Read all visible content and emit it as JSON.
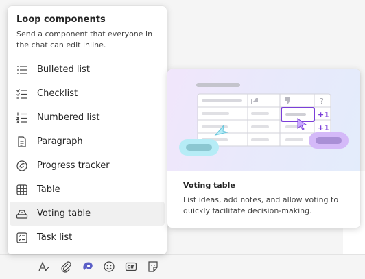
{
  "menu": {
    "title": "Loop components",
    "description": "Send a component that everyone in the chat can edit inline.",
    "items": [
      {
        "label": "Bulleted list",
        "icon": "bulleted-list-icon"
      },
      {
        "label": "Checklist",
        "icon": "checklist-icon"
      },
      {
        "label": "Numbered list",
        "icon": "numbered-list-icon"
      },
      {
        "label": "Paragraph",
        "icon": "paragraph-icon"
      },
      {
        "label": "Progress tracker",
        "icon": "progress-tracker-icon"
      },
      {
        "label": "Table",
        "icon": "table-icon"
      },
      {
        "label": "Voting table",
        "icon": "voting-table-icon",
        "active": true
      },
      {
        "label": "Task list",
        "icon": "task-list-icon"
      }
    ]
  },
  "preview": {
    "title": "Voting table",
    "description": "List ideas, add notes, and allow voting to quickly facilitate decision-making.",
    "vote_labels": [
      "+1",
      "+1"
    ],
    "help_symbol": "?",
    "accent": "#7b3fd8",
    "highlight": "#b6ecf6"
  },
  "toolbar": {
    "icons": [
      "format-icon",
      "attach-icon",
      "loop-icon",
      "emoji-icon",
      "gif-icon",
      "sticker-icon"
    ],
    "gif_label": "GIF"
  }
}
